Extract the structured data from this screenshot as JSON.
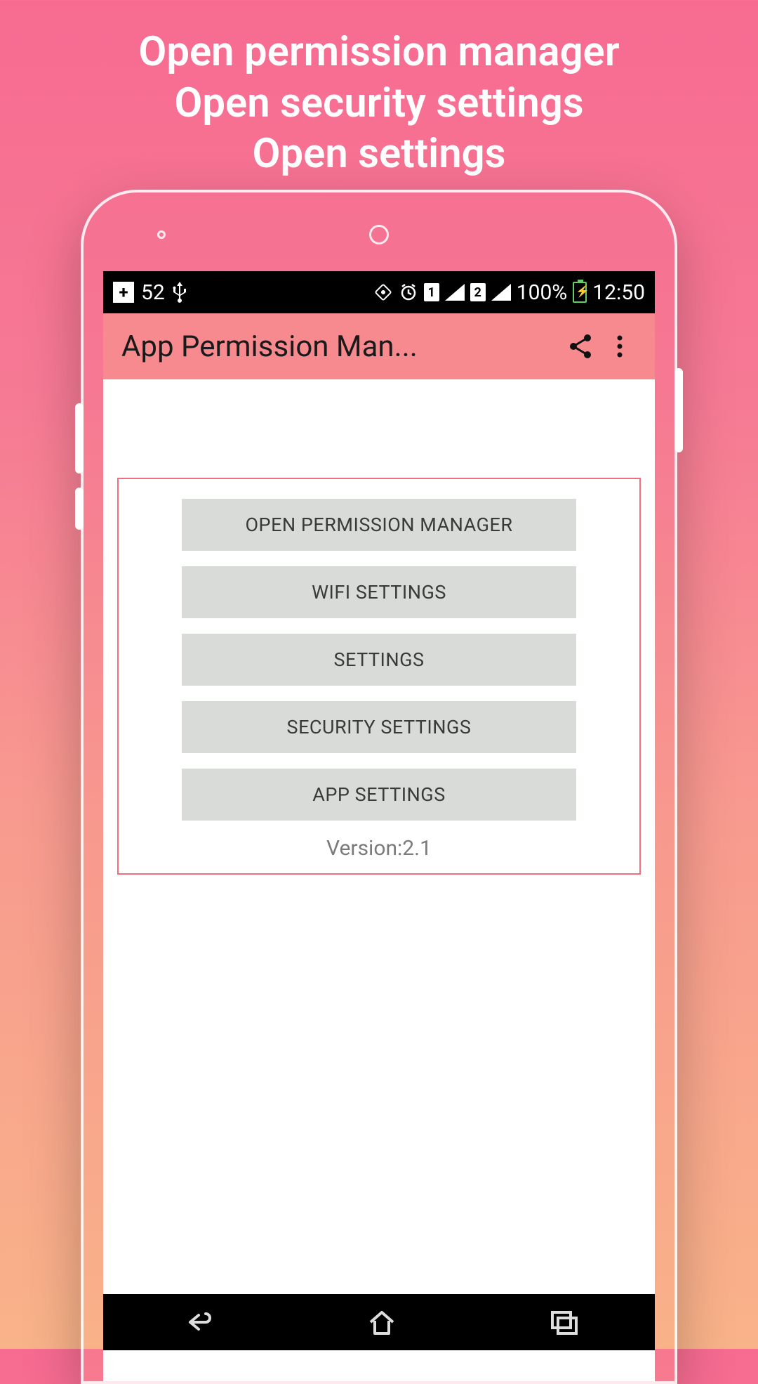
{
  "promo": {
    "line1": "Open permission manager",
    "line2": "Open security settings",
    "line3": "Open settings"
  },
  "statusbar": {
    "temp": "52",
    "battery_pct": "100%",
    "time": "12:50",
    "sim1": "1",
    "sim2": "2"
  },
  "appbar": {
    "title": "App Permission Man..."
  },
  "buttons": {
    "open_permission": "OPEN PERMISSION MANAGER",
    "wifi": "WIFI SETTINGS",
    "settings": "SETTINGS",
    "security": "SECURITY SETTINGS",
    "app": "APP SETTINGS"
  },
  "version_label": "Version:2.1"
}
